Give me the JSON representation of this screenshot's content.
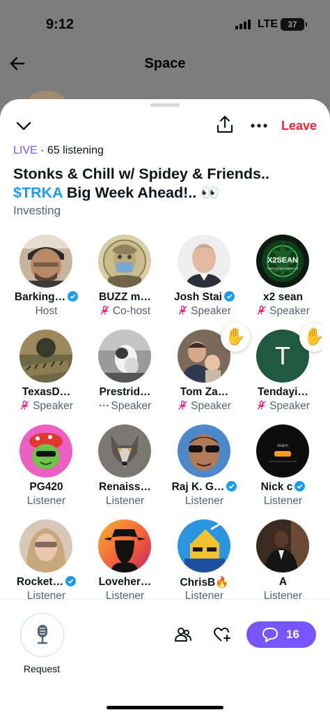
{
  "status_bar": {
    "time": "9:12",
    "network": "LTE",
    "battery": "37"
  },
  "header": {
    "back_icon": "arrow-left-icon",
    "title": "Space"
  },
  "sheet": {
    "leave_label": "Leave",
    "live_label": "LIVE",
    "listening": "· 65 listening",
    "title_part1": "Stonks & Chill w/ Spidey & Friends..",
    "cashtag": "$TRKA",
    "title_part2": " Big Week Ahead!.. 👀",
    "topic": "Investing"
  },
  "participants": [
    {
      "name": "Barking…",
      "verified": true,
      "role": "Host",
      "muted": false,
      "hand": false
    },
    {
      "name": "BUZZ m…",
      "verified": false,
      "role": "Co-host",
      "muted": true,
      "hand": false
    },
    {
      "name": "Josh Stai",
      "verified": true,
      "role": "Speaker",
      "muted": true,
      "hand": false
    },
    {
      "name": "x2 sean",
      "verified": false,
      "role": "Speaker",
      "muted": true,
      "hand": false
    },
    {
      "name": "TexasD…",
      "verified": false,
      "role": "Speaker",
      "muted": true,
      "hand": false
    },
    {
      "name": "Prestrid…",
      "verified": false,
      "role": "Speaker",
      "muted": false,
      "dots": true,
      "hand": false
    },
    {
      "name": "Tom Za…",
      "verified": false,
      "role": "Speaker",
      "muted": true,
      "hand": true
    },
    {
      "name": "Tendayi…",
      "verified": false,
      "role": "Speaker",
      "muted": true,
      "hand": true
    },
    {
      "name": "PG420",
      "verified": false,
      "role": "Listener",
      "muted": false,
      "hand": false
    },
    {
      "name": "Renaiss…",
      "verified": false,
      "role": "Listener",
      "muted": false,
      "hand": false
    },
    {
      "name": "Raj K. G…",
      "verified": true,
      "role": "Listener",
      "muted": false,
      "hand": false
    },
    {
      "name": "Nick c",
      "verified": true,
      "role": "Listener",
      "muted": false,
      "hand": false
    },
    {
      "name": "Rocket…",
      "verified": true,
      "role": "Listener",
      "muted": false,
      "hand": false
    },
    {
      "name": "Loveher…",
      "verified": false,
      "role": "Listener",
      "muted": false,
      "hand": false
    },
    {
      "name": "ChrisB🔥",
      "verified": false,
      "role": "Listener",
      "muted": false,
      "hand": false
    },
    {
      "name": "A",
      "verified": false,
      "role": "Listener",
      "muted": false,
      "hand": false
    }
  ],
  "avatar_texts": {
    "x2sean": "X2SEAN",
    "x2sean_sub": "FREE & FAIR MARKETS",
    "tendayi_initial": "T",
    "nick_alarm": "Alarm"
  },
  "bottom_bar": {
    "request_label": "Request",
    "comments_count": "16",
    "icons": [
      "microphone-icon",
      "people-icon",
      "heart-plus-icon",
      "comment-icon"
    ]
  },
  "colors": {
    "accent": "#7856ff",
    "leave": "#f4212e",
    "cashtag": "#1d9bf0",
    "muted_mic": "#f91880",
    "verified": "#1d9bf0"
  }
}
